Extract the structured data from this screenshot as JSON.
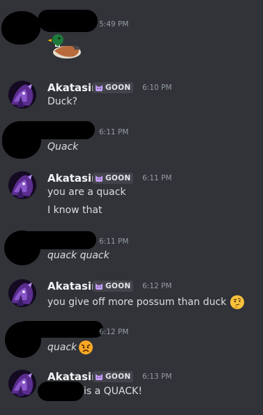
{
  "colors": {
    "background": "#313338",
    "username": "#f2f3f5",
    "message_text": "#dbdee1",
    "timestamp": "#949ba4",
    "tag_background": "#43444b",
    "tag_icon": "#c59cff"
  },
  "messages": [
    {
      "author": "",
      "author_redacted": true,
      "time": "5:49 PM",
      "lines": [],
      "attachment_emoji": "duck-emoji"
    },
    {
      "author": "Akatasin",
      "tag": "GOON",
      "time": "6:10 PM",
      "lines": [
        "Duck?"
      ]
    },
    {
      "author": "",
      "author_redacted": true,
      "time": "6:11 PM",
      "lines": [
        "Quack"
      ],
      "italic": true
    },
    {
      "author": "Akatasin",
      "tag": "GOON",
      "time": "6:11 PM",
      "lines": [
        "you are a quack",
        "I know that"
      ]
    },
    {
      "author": "",
      "author_redacted": true,
      "time": "6:11 PM",
      "lines": [
        "quack quack"
      ],
      "italic": true
    },
    {
      "author": "Akatasin",
      "tag": "GOON",
      "time": "6:12 PM",
      "lines": [
        "you give off more possum than duck"
      ],
      "trailing_emoji": "thinking-face-emoji"
    },
    {
      "author": "",
      "author_redacted": true,
      "time": "6:12 PM",
      "lines": [
        "quack"
      ],
      "italic": true,
      "trailing_emoji": "angry-face-emoji"
    },
    {
      "author": "Akatasin",
      "tag": "GOON",
      "time": "6:13 PM",
      "lines": [
        "is a QUACK!"
      ],
      "redacted_mention": true
    }
  ]
}
